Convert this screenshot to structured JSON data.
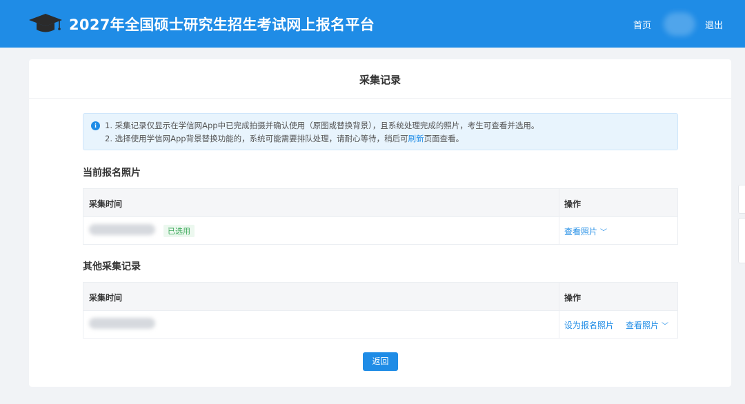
{
  "header": {
    "site_title": "2027年全国硕士研究生招生考试网上报名平台",
    "nav_home": "首页",
    "nav_logout": "退出",
    "logo_icon": "graduation-cap-icon",
    "brand_color": "#1f8ce6"
  },
  "page": {
    "title": "采集记录"
  },
  "notice": {
    "line1": "1. 采集记录仅显示在学信网App中已完成拍摄并确认使用（原图或替换背景），且系统处理完成的照片，考生可查看并选用。",
    "line2_before": "2. 选择使用学信网App背景替换功能的，系统可能需要排队处理，请耐心等待，稍后可",
    "line2_link": "刷新",
    "line2_after": "页面查看。"
  },
  "current": {
    "section_title": "当前报名照片",
    "col_time": "采集时间",
    "col_action": "操作",
    "row": {
      "tag": "已选用",
      "view_label": "查看照片"
    }
  },
  "others": {
    "section_title": "其他采集记录",
    "col_time": "采集时间",
    "col_action": "操作",
    "row": {
      "set_label": "设为报名照片",
      "view_label": "查看照片"
    }
  },
  "actions": {
    "back_label": "返回"
  }
}
